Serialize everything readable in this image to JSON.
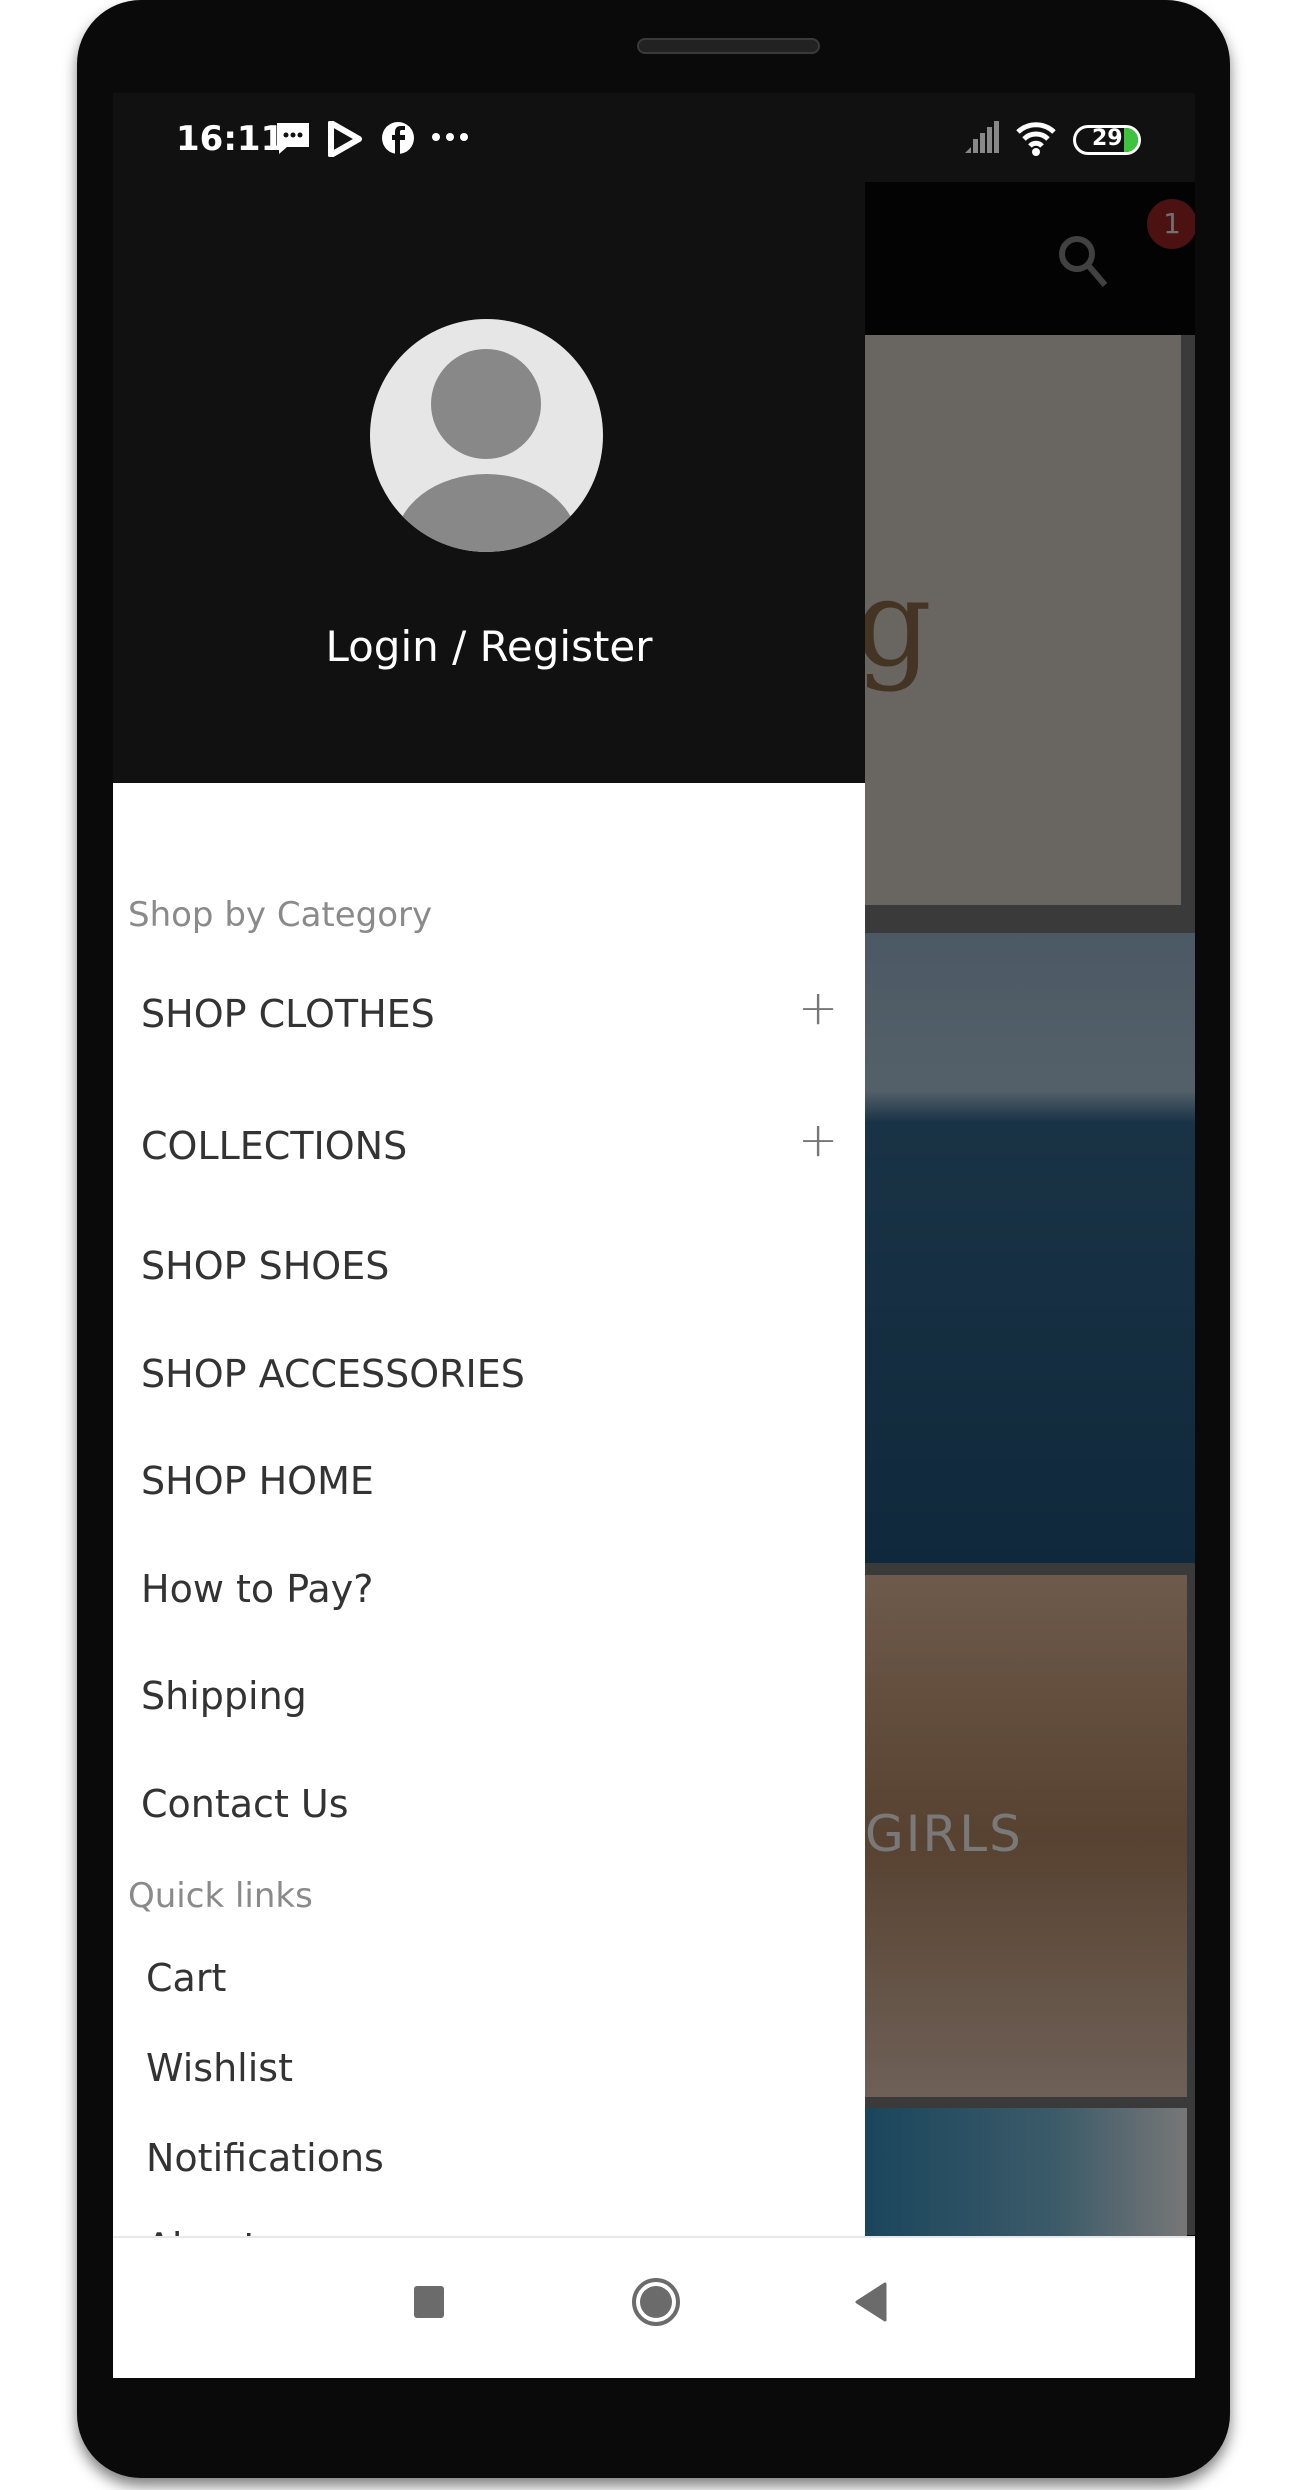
{
  "status_bar": {
    "time": "16:11",
    "battery": "29",
    "icons": [
      "message-icon",
      "play-store-icon",
      "facebook-icon",
      "more-icon",
      "signal-icon",
      "wifi-icon",
      "battery-icon"
    ]
  },
  "app_bar": {
    "cart_badge": "1",
    "icons": [
      "search-icon",
      "cart-icon"
    ]
  },
  "drawer": {
    "login_label": "Login / Register",
    "category_heading": "Shop by Category",
    "categories": [
      {
        "label": "SHOP CLOTHES",
        "expandable": true
      },
      {
        "label": "COLLECTIONS",
        "expandable": true
      },
      {
        "label": "SHOP SHOES"
      },
      {
        "label": "SHOP ACCESSORIES"
      },
      {
        "label": "SHOP HOME"
      },
      {
        "label": "How to Pay?"
      },
      {
        "label": "Shipping"
      },
      {
        "label": "Contact Us"
      }
    ],
    "quick_links_heading": "Quick links",
    "quick_links": [
      "Cart",
      "Wishlist",
      "Notifications",
      "About"
    ]
  },
  "content": {
    "banner_text": "GIRLS"
  },
  "colors": {
    "badge": "#8b2020",
    "drawer_header": "#111111",
    "battery_fill": "#3fc23f"
  }
}
